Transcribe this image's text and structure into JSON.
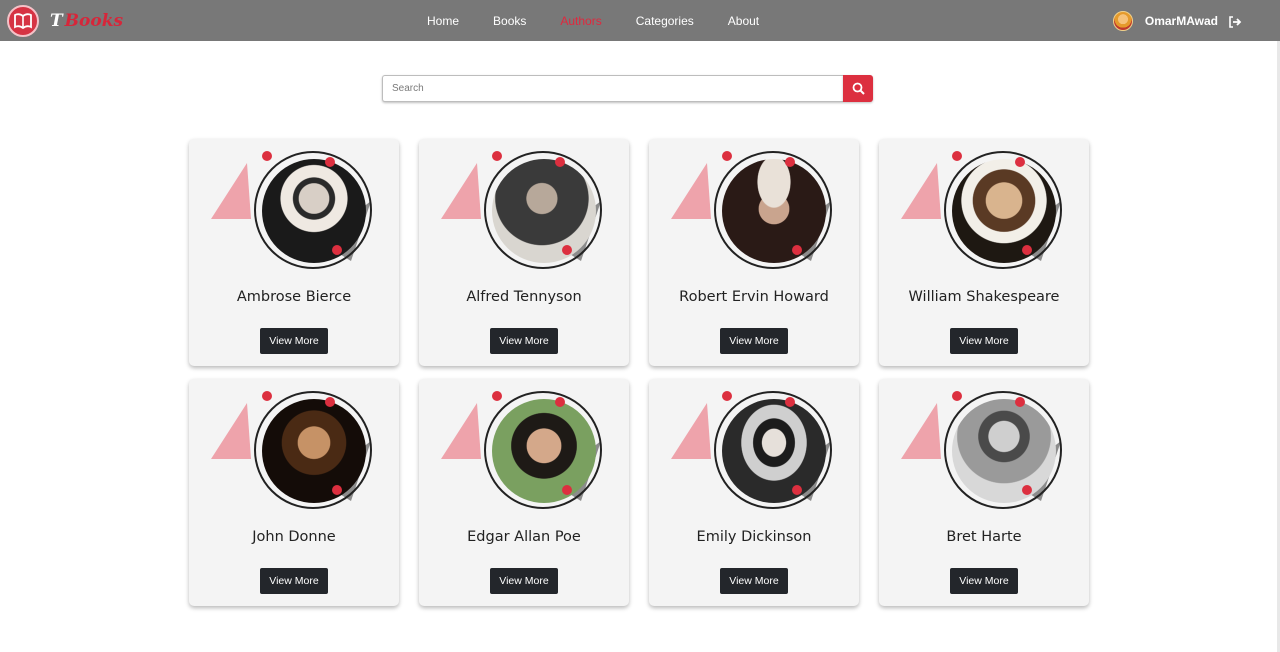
{
  "brand": {
    "t": "T",
    "books": "Books",
    "logo_icon": "open-book-icon"
  },
  "nav": {
    "links": [
      {
        "label": "Home",
        "active": false
      },
      {
        "label": "Books",
        "active": false
      },
      {
        "label": "Authors",
        "active": true
      },
      {
        "label": "Categories",
        "active": false
      },
      {
        "label": "About",
        "active": false
      }
    ]
  },
  "user": {
    "name": "OmarMAwad",
    "logout_icon": "sign-out-icon"
  },
  "search": {
    "placeholder": "Search",
    "value": "",
    "button_icon": "search-icon"
  },
  "colors": {
    "accent": "#dc2f3f",
    "navbar": "#787878",
    "card": "#f4f4f4",
    "button": "#23262b",
    "pink_triangle": "#eea3ab",
    "gray_triangle": "#8c8c8c"
  },
  "authors": [
    {
      "name": "Ambrose Bierce",
      "button": "View More",
      "portrait_tone": "#b8b0a8"
    },
    {
      "name": "Alfred Tennyson",
      "button": "View More",
      "portrait_tone": "#c9c6c0"
    },
    {
      "name": "Robert Ervin Howard",
      "button": "View More",
      "portrait_tone": "#8a4a3c"
    },
    {
      "name": "William Shakespeare",
      "button": "View More",
      "portrait_tone": "#7a5a44"
    },
    {
      "name": "John Donne",
      "button": "View More",
      "portrait_tone": "#5a3a22"
    },
    {
      "name": "Edgar Allan Poe",
      "button": "View More",
      "portrait_tone": "#7aa060"
    },
    {
      "name": "Emily Dickinson",
      "button": "View More",
      "portrait_tone": "#c8c8c8"
    },
    {
      "name": "Bret Harte",
      "button": "View More",
      "portrait_tone": "#b4b4b4"
    }
  ]
}
